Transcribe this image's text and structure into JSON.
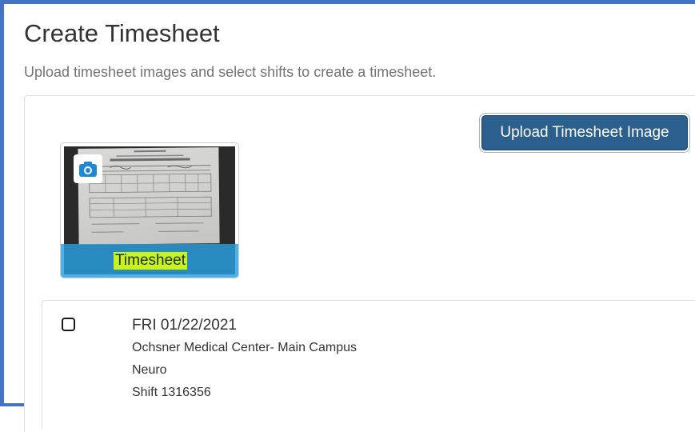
{
  "page": {
    "title": "Create Timesheet",
    "subtitle": "Upload timesheet images and select shifts to create a timesheet."
  },
  "upload": {
    "button_label": "Upload Timesheet Image"
  },
  "thumbnail": {
    "caption": "Timesheet",
    "icon": "camera-icon",
    "caption_highlight_color": "#c8f41a",
    "caption_bar_color": "#28a0e1"
  },
  "shifts": [
    {
      "checked": false,
      "date": "FRI 01/22/2021",
      "facility": "Ochsner Medical Center- Main Campus",
      "unit": "Neuro",
      "shift": "Shift 1316356"
    }
  ],
  "colors": {
    "primary_button": "#2b5f8e",
    "screenshot_border": "#4472c4",
    "camera_icon": "#1e88d6"
  }
}
